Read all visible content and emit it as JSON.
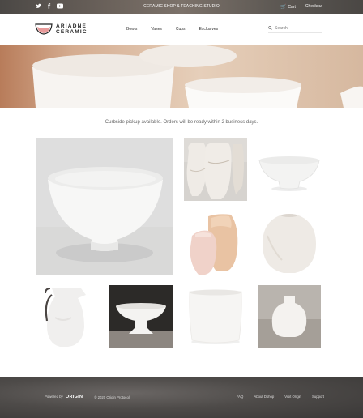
{
  "topbar": {
    "social": [
      {
        "name": "twitter-icon",
        "glyph": "t"
      },
      {
        "name": "facebook-icon",
        "glyph": "f"
      },
      {
        "name": "youtube-icon",
        "glyph": "▶"
      }
    ],
    "title": "CERAMIC SHOP & TEACHING STUDIO",
    "cart_label": "Cart",
    "checkout_label": "Checkout"
  },
  "header": {
    "logo_line1": "ARIADNE",
    "logo_line2": "CERAMIC",
    "nav": [
      "Bowls",
      "Vases",
      "Cups",
      "Exclusives"
    ],
    "search_placeholder": "Search"
  },
  "notice": "Curbside pickup available. Orders will be ready within 2 business days.",
  "footer": {
    "powered_by": "Powered by",
    "origin_logo": "ORIGIN",
    "copyright": "© 2020 Origin Protocol",
    "links": [
      "FAQ",
      "About Dshop",
      "Visit Origin",
      "Support"
    ]
  },
  "colors": {
    "accent": "#d98a8a",
    "topbar": "#5e5954",
    "footer": "#4a4745"
  }
}
